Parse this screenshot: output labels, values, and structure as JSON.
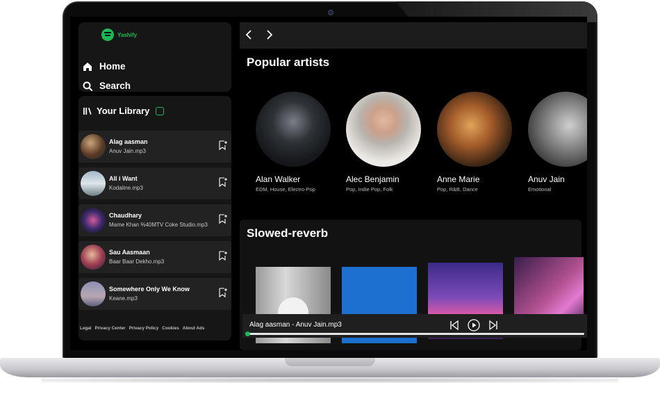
{
  "app": {
    "name": "Yashify"
  },
  "nav": {
    "home": "Home",
    "search": "Search"
  },
  "library": {
    "title": "Your Library",
    "songs": [
      {
        "title": "Alag aasman",
        "file": "Anuv Jain.mp3"
      },
      {
        "title": "All i Want",
        "file": "Kodaline.mp3"
      },
      {
        "title": "Chaudhary",
        "file": "Mame Khan %40MTV Coke Studio.mp3"
      },
      {
        "title": "Sau Aasmaan",
        "file": "Baar Baar Dekho.mp3"
      },
      {
        "title": "Somewhere Only We Know",
        "file": "Keane.mp3"
      }
    ],
    "footer_links": [
      "Legal",
      "Privacy Center",
      "Privacy Policy",
      "Cookies",
      "About Ads"
    ]
  },
  "popular": {
    "title": "Popular artists",
    "artists": [
      {
        "name": "Alan Walker",
        "genre": "EDM, House, Electro-Pop"
      },
      {
        "name": "Alec Benjamin",
        "genre": "Pop, Indie Pop, Folk"
      },
      {
        "name": "Anne Marie",
        "genre": "Pop, R&B, Dance"
      },
      {
        "name": "Anuv Jain",
        "genre": "Emotional"
      }
    ]
  },
  "slowed": {
    "title": "Slowed-reverb"
  },
  "player": {
    "now_playing": "Alag aasman - Anuv Jain.mp3",
    "progress": 0.01
  },
  "icons": [
    "home-icon",
    "search-icon",
    "library-icon",
    "add-playlist-icon",
    "back-arrow-icon",
    "forward-arrow-icon",
    "previous-icon",
    "play-icon",
    "next-icon"
  ],
  "colors": {
    "accent": "#1db954",
    "background": "#000000",
    "panel": "#161616"
  }
}
